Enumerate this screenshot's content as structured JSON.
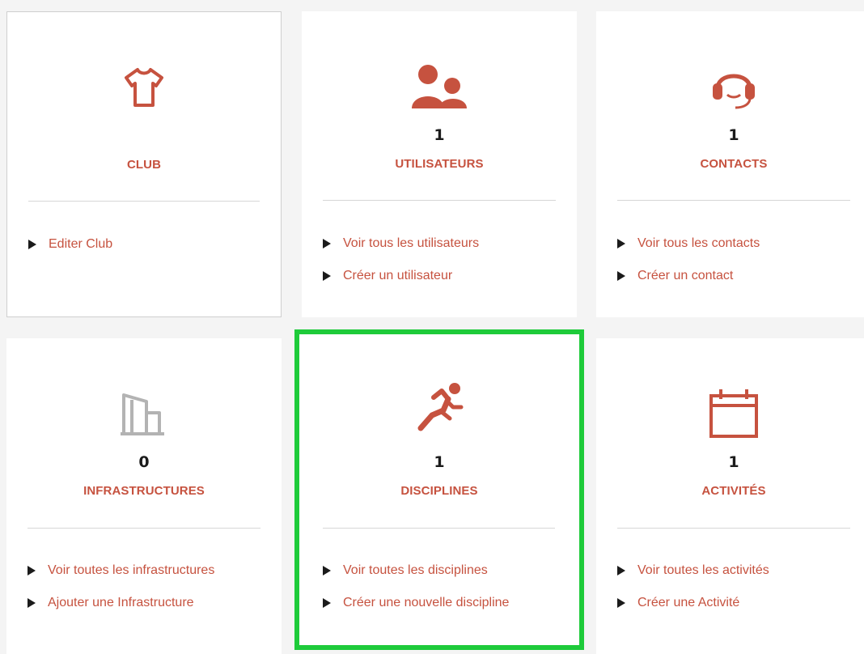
{
  "colors": {
    "accent": "#c6523f",
    "muted_icon": "#b3b3b3",
    "selected_border": "#1ecb3a"
  },
  "cards": [
    {
      "name": "club",
      "icon": "tshirt-icon",
      "count": "",
      "title": "CLUB",
      "links": [
        "Editer Club"
      ]
    },
    {
      "name": "utilisateurs",
      "icon": "users-icon",
      "count": "1",
      "title": "UTILISATEURS",
      "links": [
        "Voir tous les utilisateurs",
        "Créer un utilisateur"
      ]
    },
    {
      "name": "contacts",
      "icon": "headset-icon",
      "count": "1",
      "title": "CONTACTS",
      "links": [
        "Voir tous les contacts",
        "Créer un contact"
      ]
    },
    {
      "name": "infrastructures",
      "icon": "building-icon",
      "count": "0",
      "title": "INFRASTRUCTURES",
      "links": [
        "Voir toutes les infrastructures",
        "Ajouter une Infrastructure"
      ]
    },
    {
      "name": "disciplines",
      "icon": "runner-icon",
      "count": "1",
      "title": "DISCIPLINES",
      "links": [
        "Voir toutes les disciplines",
        "Créer une nouvelle discipline"
      ]
    },
    {
      "name": "activites",
      "icon": "calendar-icon",
      "count": "1",
      "title": "ACTIVITÉS",
      "links": [
        "Voir toutes les activités",
        "Créer une Activité"
      ]
    }
  ]
}
